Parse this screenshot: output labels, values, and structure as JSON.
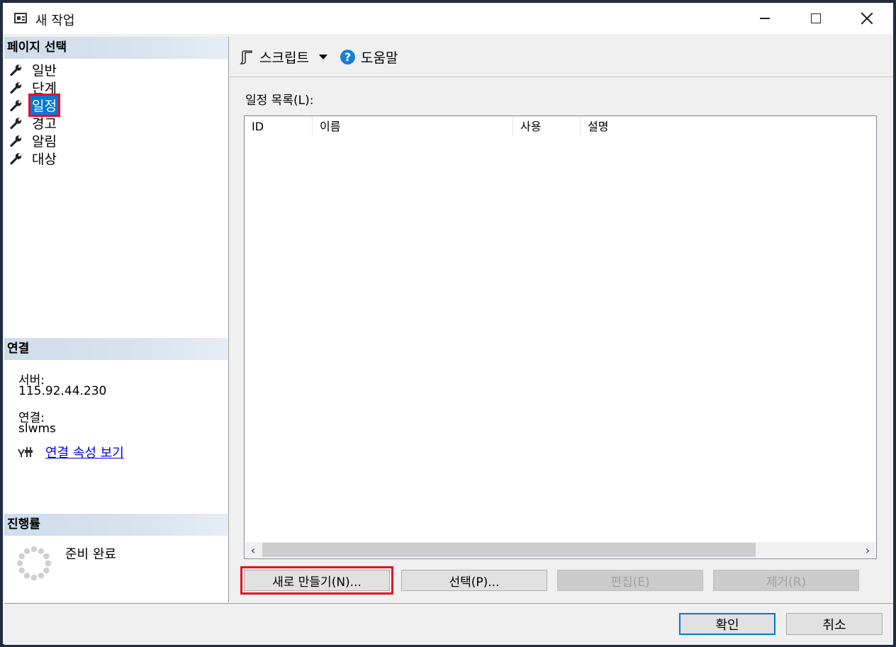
{
  "window": {
    "title": "새 작업"
  },
  "left": {
    "page_select_header": "페이지 선택",
    "nav_items": [
      {
        "label": "일반",
        "icon": "wrench-icon"
      },
      {
        "label": "단계",
        "icon": "wrench-icon"
      },
      {
        "label": "일정",
        "icon": "wrench-icon",
        "selected": true
      },
      {
        "label": "경고",
        "icon": "wrench-icon"
      },
      {
        "label": "알림",
        "icon": "wrench-icon"
      },
      {
        "label": "대상",
        "icon": "wrench-icon"
      }
    ],
    "connection_header": "연결",
    "server_label": "서버:",
    "server_value": "115.92.44.230",
    "connection_label": "연결:",
    "connection_value": "slwms",
    "view_connection_link": "연결 속성 보기",
    "progress_header": "진행률",
    "progress_status": "준비 완료"
  },
  "toolbar": {
    "script_label": "스크립트",
    "help_label": "도움말"
  },
  "main": {
    "list_label": "일정 목록(L):",
    "columns": [
      "ID",
      "이름",
      "사용",
      "설명"
    ],
    "rows": [],
    "buttons": {
      "new": "새로 만들기(N)...",
      "pick": "선택(P)...",
      "edit": "편집(E)",
      "remove": "제거(R)"
    }
  },
  "dialog_buttons": {
    "ok": "확인",
    "cancel": "취소"
  },
  "colors": {
    "selection": "#0078d7",
    "highlight_box": "#e81123",
    "link": "#0000ee"
  }
}
